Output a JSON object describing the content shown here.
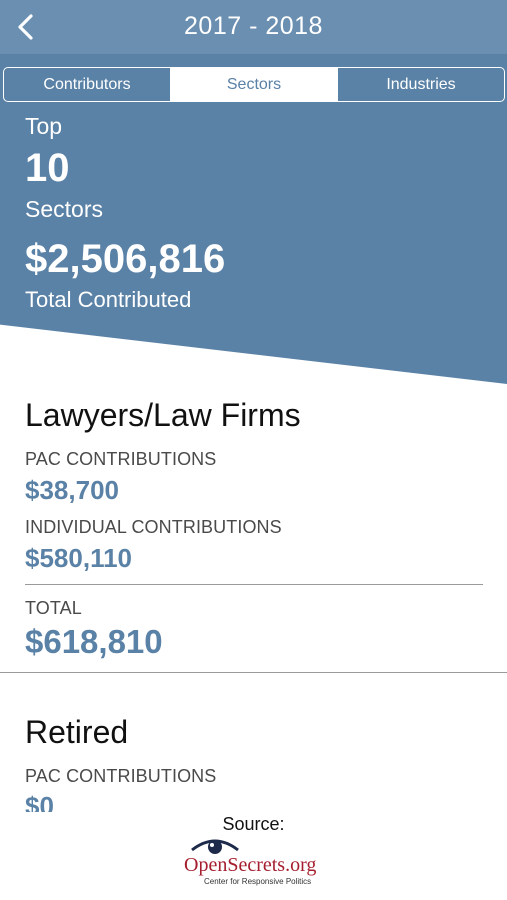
{
  "header": {
    "title": "2017 - 2018"
  },
  "tabs": [
    {
      "label": "Contributors",
      "active": false
    },
    {
      "label": "Sectors",
      "active": true
    },
    {
      "label": "Industries",
      "active": false
    }
  ],
  "summary": {
    "top_label": "Top",
    "count": "10",
    "unit_label": "Sectors",
    "total_amount": "$2,506,816",
    "total_label": "Total Contributed"
  },
  "sectors": [
    {
      "name": "Lawyers/Law Firms",
      "pac_label": "PAC CONTRIBUTIONS",
      "pac_value": "$38,700",
      "individual_label": "INDIVIDUAL CONTRIBUTIONS",
      "individual_value": "$580,110",
      "total_label": "TOTAL",
      "total_value": "$618,810"
    },
    {
      "name": "Retired",
      "pac_label": "PAC CONTRIBUTIONS",
      "pac_value": "$0"
    }
  ],
  "footer": {
    "source_label": "Source:",
    "logo_text": "OpenSecrets.org",
    "logo_tagline": "Center for Responsive Politics"
  },
  "colors": {
    "nav_bar": "#6b8fb1",
    "hero": "#5a81a6",
    "value_text": "#5a81a6",
    "logo_red": "#a51e2e"
  },
  "icons": {
    "back": "chevron-left-icon",
    "logo_eye": "eye-icon"
  }
}
